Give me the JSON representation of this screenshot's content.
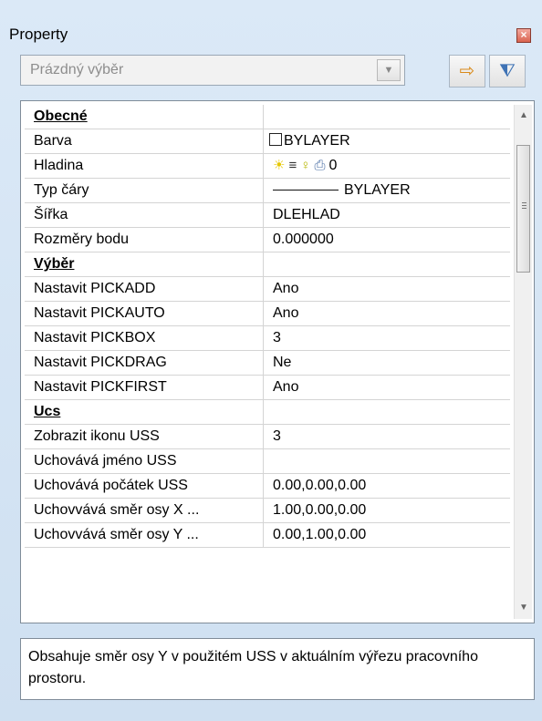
{
  "window": {
    "title": "Property"
  },
  "selection_combo": {
    "value": "Prázdný výběr"
  },
  "colors": {
    "background": "#c3d9ee",
    "close_button": "#d9634f",
    "grid_lines": "#d4d4d4"
  },
  "properties": [
    {
      "type": "category",
      "name": "Obecné"
    },
    {
      "type": "prop",
      "name": "Barva",
      "value": "BYLAYER",
      "icon": "color-swatch"
    },
    {
      "type": "prop",
      "name": "Hladina",
      "value": "0",
      "icon": "layer-state-icons"
    },
    {
      "type": "prop",
      "name": "Typ čáry",
      "value": "BYLAYER",
      "icon": "linetype-sample"
    },
    {
      "type": "prop",
      "name": "Šířka",
      "value": "DLEHLAD"
    },
    {
      "type": "prop",
      "name": "Rozměry bodu",
      "value": "0.000000"
    },
    {
      "type": "category",
      "name": "Výběr"
    },
    {
      "type": "prop",
      "name": "Nastavit PICKADD",
      "value": "Ano"
    },
    {
      "type": "prop",
      "name": "Nastavit PICKAUTO",
      "value": "Ano"
    },
    {
      "type": "prop",
      "name": "Nastavit PICKBOX",
      "value": "3"
    },
    {
      "type": "prop",
      "name": "Nastavit PICKDRAG",
      "value": "Ne"
    },
    {
      "type": "prop",
      "name": "Nastavit PICKFIRST",
      "value": "Ano"
    },
    {
      "type": "category",
      "name": "Ucs"
    },
    {
      "type": "prop",
      "name": "Zobrazit ikonu USS",
      "value": "3"
    },
    {
      "type": "prop",
      "name": "Uchovává jméno USS",
      "value": ""
    },
    {
      "type": "prop",
      "name": "Uchovává počátek USS",
      "value": "0.00,0.00,0.00"
    },
    {
      "type": "prop",
      "name": "Uchovvává směr osy X ...",
      "value": "1.00,0.00,0.00"
    },
    {
      "type": "prop",
      "name": "Uchovvává směr osy Y ...",
      "value": "0.00,1.00,0.00"
    }
  ],
  "description": "Obsahuje směr osy Y v použitém USS v aktuálním výřezu pracovního prostoru."
}
